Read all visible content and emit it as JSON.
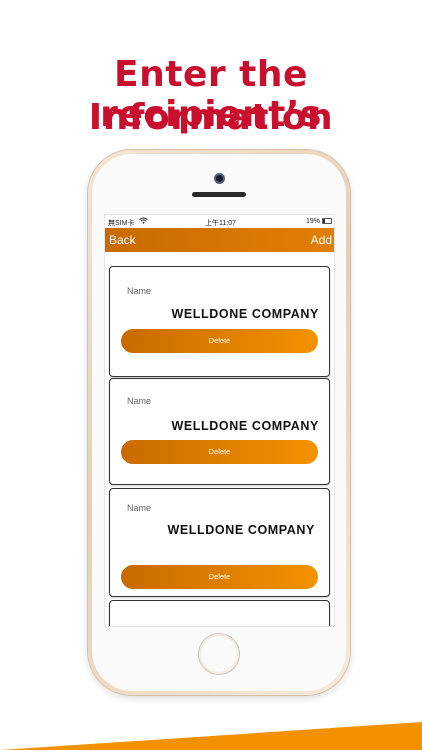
{
  "promo": {
    "line1": "Enter the recipient’s",
    "line2": "Information"
  },
  "status_bar": {
    "carrier": "無SIM卡",
    "wifi_icon": "wifi-icon",
    "time": "上午11:07",
    "battery": "19%"
  },
  "nav": {
    "back_label": "Back",
    "add_label": "Add"
  },
  "recipients": [
    {
      "name_label": "Name",
      "name_value": "WELLDONE COMPANY",
      "delete_label": "Delete"
    },
    {
      "name_label": "Name",
      "name_value": "WELLDONE COMPANY",
      "delete_label": "Delete"
    },
    {
      "name_label": "Name",
      "name_value": "WELLDONE COMPANY",
      "delete_label": "Delete"
    }
  ],
  "colors": {
    "headline": "#c8102e",
    "accent_start": "#c96a00",
    "accent_end": "#f39200"
  }
}
